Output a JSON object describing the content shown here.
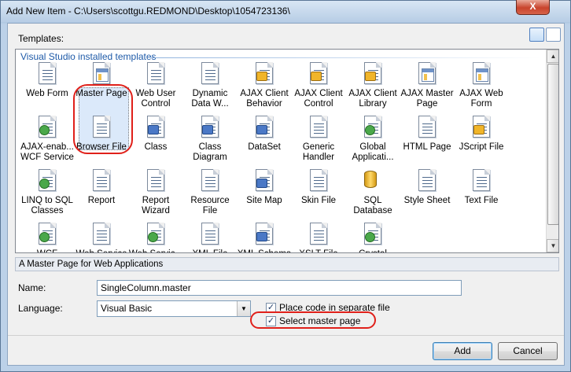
{
  "window": {
    "title": "Add New Item - C:\\Users\\scottgu.REDMOND\\Desktop\\1054723136\\",
    "close_label": "X"
  },
  "templates": {
    "label": "Templates:",
    "group_header": "Visual Studio installed templates",
    "items": [
      {
        "label": "Web Form",
        "icon": "web-form-icon"
      },
      {
        "label": "Master Page",
        "icon": "master-page-icon"
      },
      {
        "label": "Web User\nControl",
        "icon": "web-user-control-icon"
      },
      {
        "label": "Dynamic\nData W...",
        "icon": "dynamic-data-icon"
      },
      {
        "label": "AJAX Client\nBehavior",
        "icon": "ajax-client-behavior-icon"
      },
      {
        "label": "AJAX Client\nControl",
        "icon": "ajax-client-control-icon"
      },
      {
        "label": "AJAX Client\nLibrary",
        "icon": "ajax-client-library-icon"
      },
      {
        "label": "AJAX Master\nPage",
        "icon": "ajax-master-page-icon"
      },
      {
        "label": "AJAX Web\nForm",
        "icon": "ajax-web-form-icon"
      },
      {
        "label": "AJAX-enab...\nWCF Service",
        "icon": "ajax-wcf-service-icon"
      },
      {
        "label": "Browser File",
        "icon": "browser-file-icon"
      },
      {
        "label": "Class",
        "icon": "class-icon"
      },
      {
        "label": "Class\nDiagram",
        "icon": "class-diagram-icon"
      },
      {
        "label": "DataSet",
        "icon": "dataset-icon"
      },
      {
        "label": "Generic\nHandler",
        "icon": "generic-handler-icon"
      },
      {
        "label": "Global\nApplicati...",
        "icon": "global-application-icon"
      },
      {
        "label": "HTML Page",
        "icon": "html-page-icon"
      },
      {
        "label": "JScript File",
        "icon": "jscript-file-icon"
      },
      {
        "label": "LINQ to SQL\nClasses",
        "icon": "linq-to-sql-icon"
      },
      {
        "label": "Report",
        "icon": "report-icon"
      },
      {
        "label": "Report\nWizard",
        "icon": "report-wizard-icon"
      },
      {
        "label": "Resource File",
        "icon": "resource-file-icon"
      },
      {
        "label": "Site Map",
        "icon": "site-map-icon"
      },
      {
        "label": "Skin File",
        "icon": "skin-file-icon"
      },
      {
        "label": "SQL\nDatabase",
        "icon": "sql-database-icon"
      },
      {
        "label": "Style Sheet",
        "icon": "style-sheet-icon"
      },
      {
        "label": "Text File",
        "icon": "text-file-icon"
      },
      {
        "label": "WCF Servic...",
        "icon": "wcf-service-icon"
      },
      {
        "label": "Web Service",
        "icon": "web-service-icon"
      },
      {
        "label": "Web Servic...",
        "icon": "web-service-2-icon"
      },
      {
        "label": "XML File",
        "icon": "xml-file-icon"
      },
      {
        "label": "XML Schema",
        "icon": "xml-schema-icon"
      },
      {
        "label": "XSLT File",
        "icon": "xslt-file-icon"
      },
      {
        "label": "Crystal",
        "icon": "crystal-report-icon"
      }
    ],
    "selected": "Master Page",
    "description": "A Master Page for Web Applications"
  },
  "form": {
    "name_label": "Name:",
    "name_value": "SingleColumn.master",
    "language_label": "Language:",
    "language_value": "Visual Basic",
    "place_code_label": "Place code in separate file",
    "place_code_checked": true,
    "select_master_label": "Select master page",
    "select_master_checked": true
  },
  "buttons": {
    "add": "Add",
    "cancel": "Cancel"
  },
  "colors": {
    "annotation_ring": "#e0201a",
    "group_header": "#1e5aa8"
  }
}
